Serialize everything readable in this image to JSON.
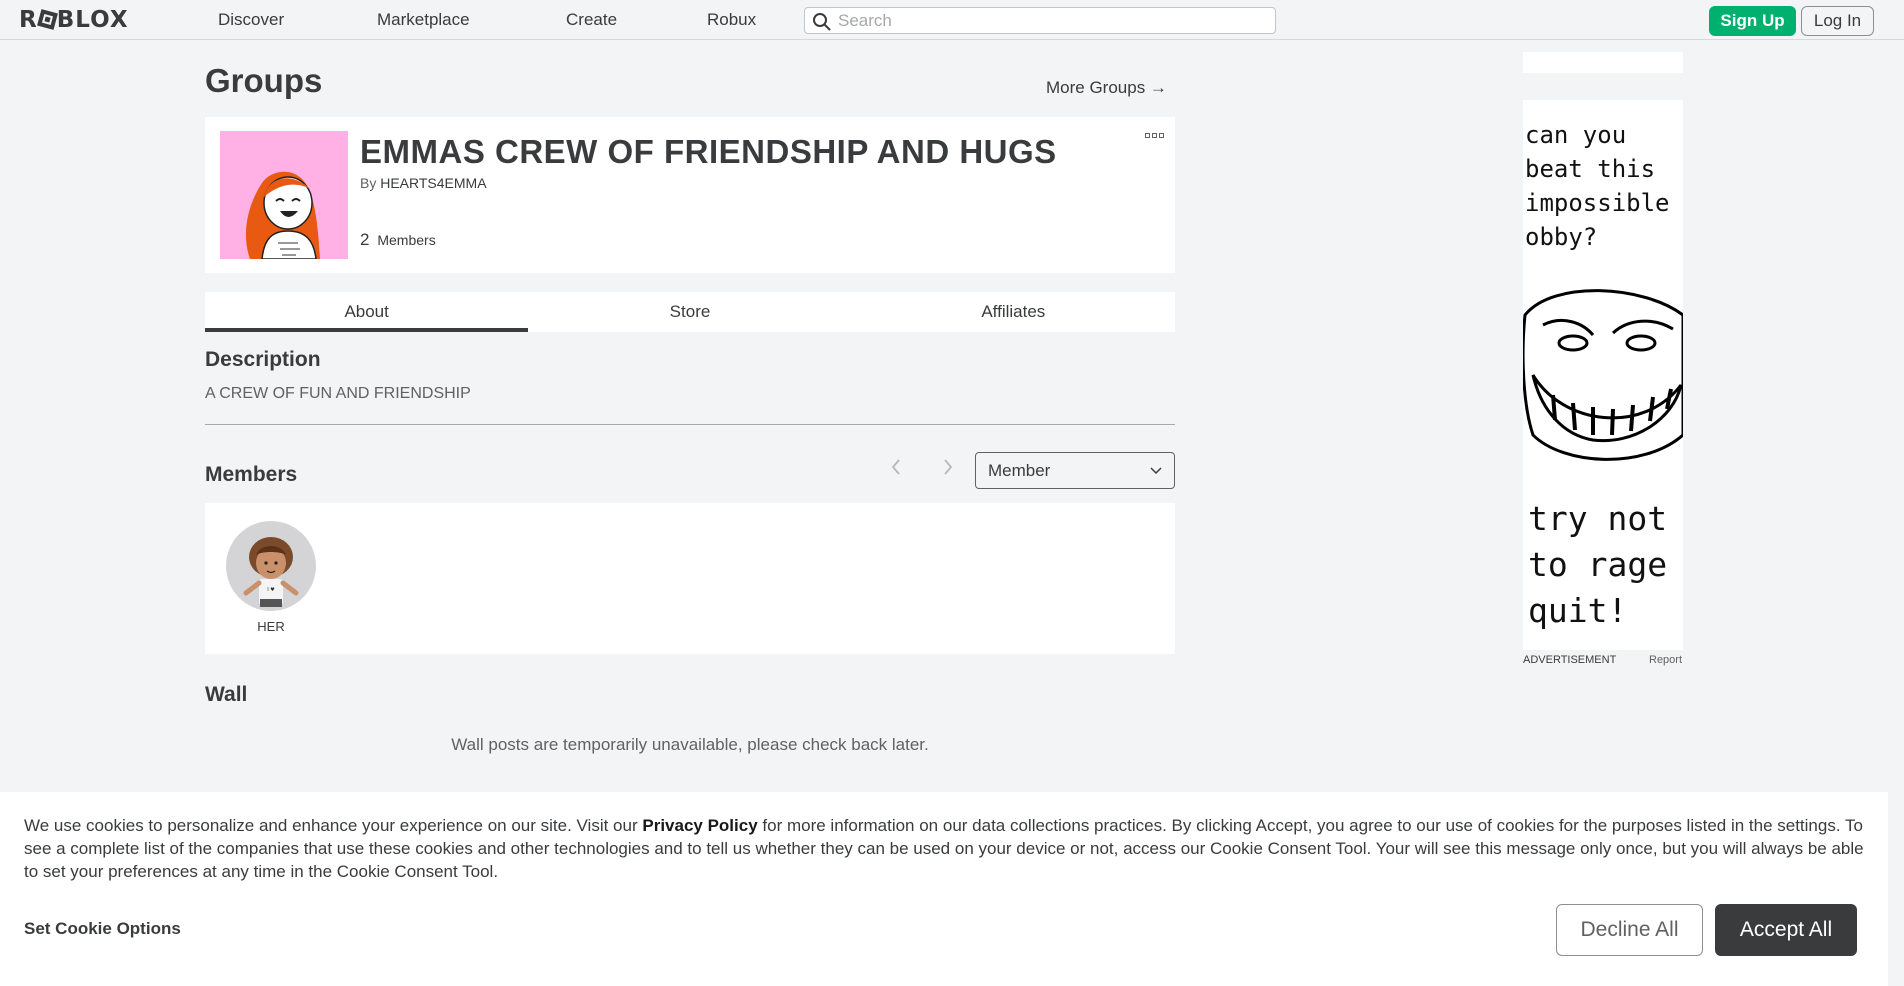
{
  "header": {
    "logo": "ROBLOX",
    "nav": [
      "Discover",
      "Marketplace",
      "Create",
      "Robux"
    ],
    "search_placeholder": "Search",
    "signup_label": "Sign Up",
    "login_label": "Log In"
  },
  "page": {
    "title": "Groups",
    "more_groups": "More Groups →"
  },
  "group": {
    "name": "EMMAS CREW OF FRIENDSHIP AND HUGS",
    "by_label": "By",
    "owner": "HEARTS4EMMA",
    "member_count": "2",
    "members_label": "Members"
  },
  "tabs": [
    "About",
    "Store",
    "Affiliates"
  ],
  "about": {
    "description_heading": "Description",
    "description": "A CREW OF FUN AND FRIENDSHIP",
    "members_heading": "Members",
    "role_selected": "Member",
    "members": [
      {
        "name": "HER"
      }
    ],
    "wall_heading": "Wall",
    "wall_message": "Wall posts are temporarily unavailable, please check back later."
  },
  "ad": {
    "text_top": [
      "can you",
      "beat this",
      "impossible",
      "obby?"
    ],
    "text_bottom": [
      "try not",
      "to rage",
      "quit!"
    ],
    "label": "ADVERTISEMENT",
    "report": "Report"
  },
  "cookie": {
    "text_before": "We use cookies to personalize and enhance your experience on our site. Visit our ",
    "privacy_link": "Privacy Policy",
    "text_after": " for more information on our data collections practices. By clicking Accept, you agree to our use of cookies for the purposes listed in the settings. To see a complete list of the companies that use these cookies and other technologies and to tell us whether they can be used on your device or not, access our Cookie Consent Tool. Your will see this message only once, but you will always be able to set your preferences at any time in the Cookie Consent Tool.",
    "options_label": "Set Cookie Options",
    "decline_label": "Decline All",
    "accept_label": "Accept All"
  },
  "colors": {
    "accent_green": "#00b06f",
    "text_dark": "#393b3d",
    "background": "#f2f4f5",
    "emblem_pink": "#ffb1e6"
  }
}
